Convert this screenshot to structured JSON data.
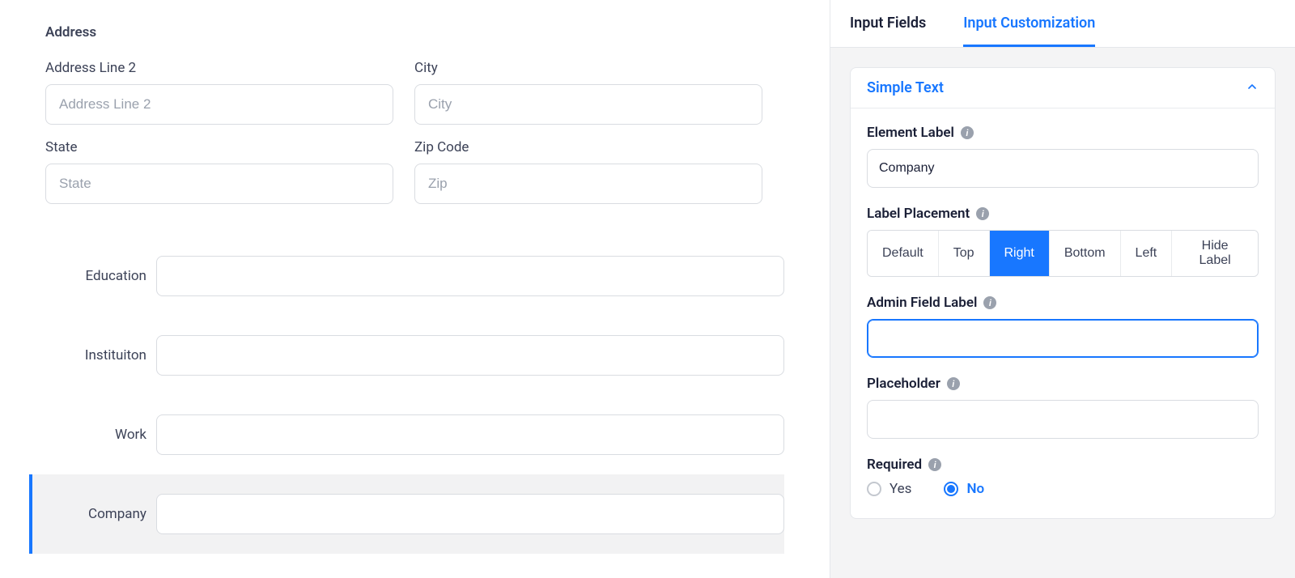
{
  "form": {
    "section_title": "Address",
    "fields": {
      "address2": {
        "label": "Address Line 2",
        "placeholder": "Address Line 2"
      },
      "city": {
        "label": "City",
        "placeholder": "City"
      },
      "state": {
        "label": "State",
        "placeholder": "State"
      },
      "zip": {
        "label": "Zip Code",
        "placeholder": "Zip"
      }
    },
    "left_label_fields": {
      "education": {
        "label": "Education"
      },
      "institution": {
        "label": "Instituiton"
      },
      "work": {
        "label": "Work"
      },
      "company": {
        "label": "Company"
      }
    }
  },
  "side": {
    "tabs": {
      "input_fields": "Input Fields",
      "input_customization": "Input Customization"
    },
    "card_title": "Simple Text",
    "element_label": {
      "label": "Element Label",
      "value": "Company"
    },
    "label_placement": {
      "label": "Label Placement",
      "options": {
        "default": "Default",
        "top": "Top",
        "right": "Right",
        "bottom": "Bottom",
        "left": "Left",
        "hide": "Hide Label"
      },
      "selected": "right"
    },
    "admin_field_label": {
      "label": "Admin Field Label",
      "value": ""
    },
    "placeholder": {
      "label": "Placeholder",
      "value": ""
    },
    "required": {
      "label": "Required",
      "options": {
        "yes": "Yes",
        "no": "No"
      },
      "selected": "no"
    }
  },
  "icons": {
    "info_char": "i"
  }
}
